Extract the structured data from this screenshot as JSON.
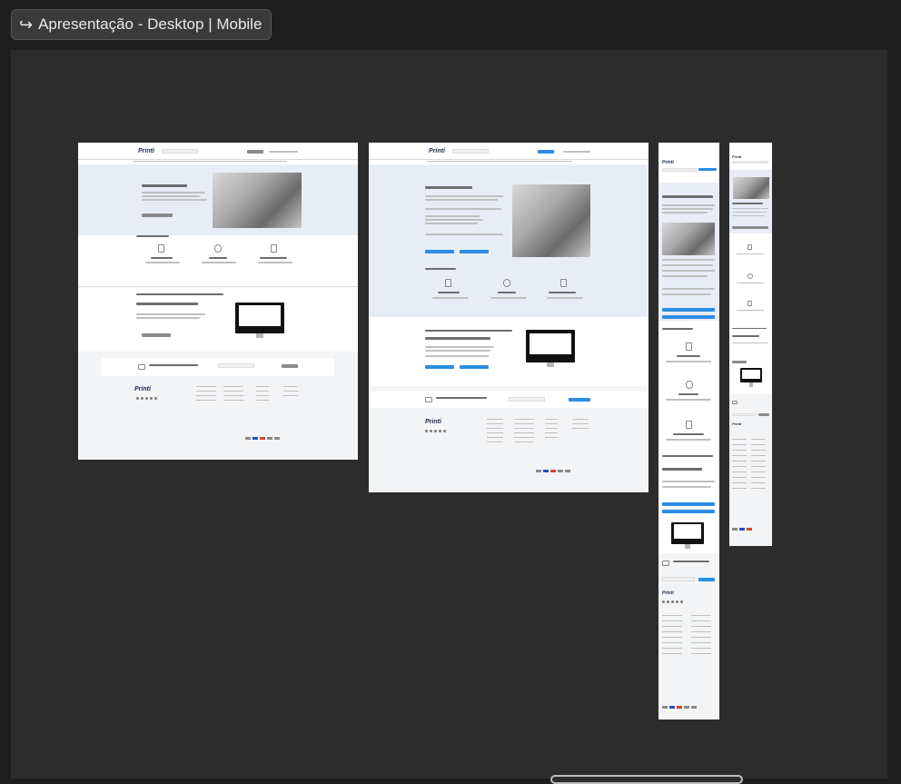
{
  "window": {
    "title": "Apresentação - Desktop | Mobile",
    "title_icon": "return-arrow-icon"
  },
  "frames": {
    "desktop_exclusivo": {
      "logo": "Printi",
      "hero_title": "Atendimento exclusivo",
      "benefit_1": "Personalização",
      "benefit_2": "Segurança",
      "benefit_3": "Pagamento faturado",
      "tool_heading": "Agilidade para seus materiais gráficos"
    },
    "desktop_4business": {
      "logo": "Printi",
      "hero_title": "Atendimento 4Business",
      "benefit_1": "Personalização",
      "benefit_2": "Segurança",
      "benefit_3": "Pagamento faturado",
      "tool_heading": "Agilidade para seus materiais gráficos"
    },
    "mobile_4business": {
      "logo": "Printi",
      "hero_title": "Atendimento 4Business",
      "benefit_1": "Personalização",
      "benefit_2": "Segurança",
      "benefit_3": "Pagamento faturado",
      "tool_heading": "Agilidade para seus materiais gráficos"
    },
    "mobile_exclusivo": {
      "logo": "Printi",
      "hero_title": "Atendimento exclusivo"
    }
  },
  "colors": {
    "canvas": "#2c2c2c",
    "accent": "#2b8de3"
  }
}
